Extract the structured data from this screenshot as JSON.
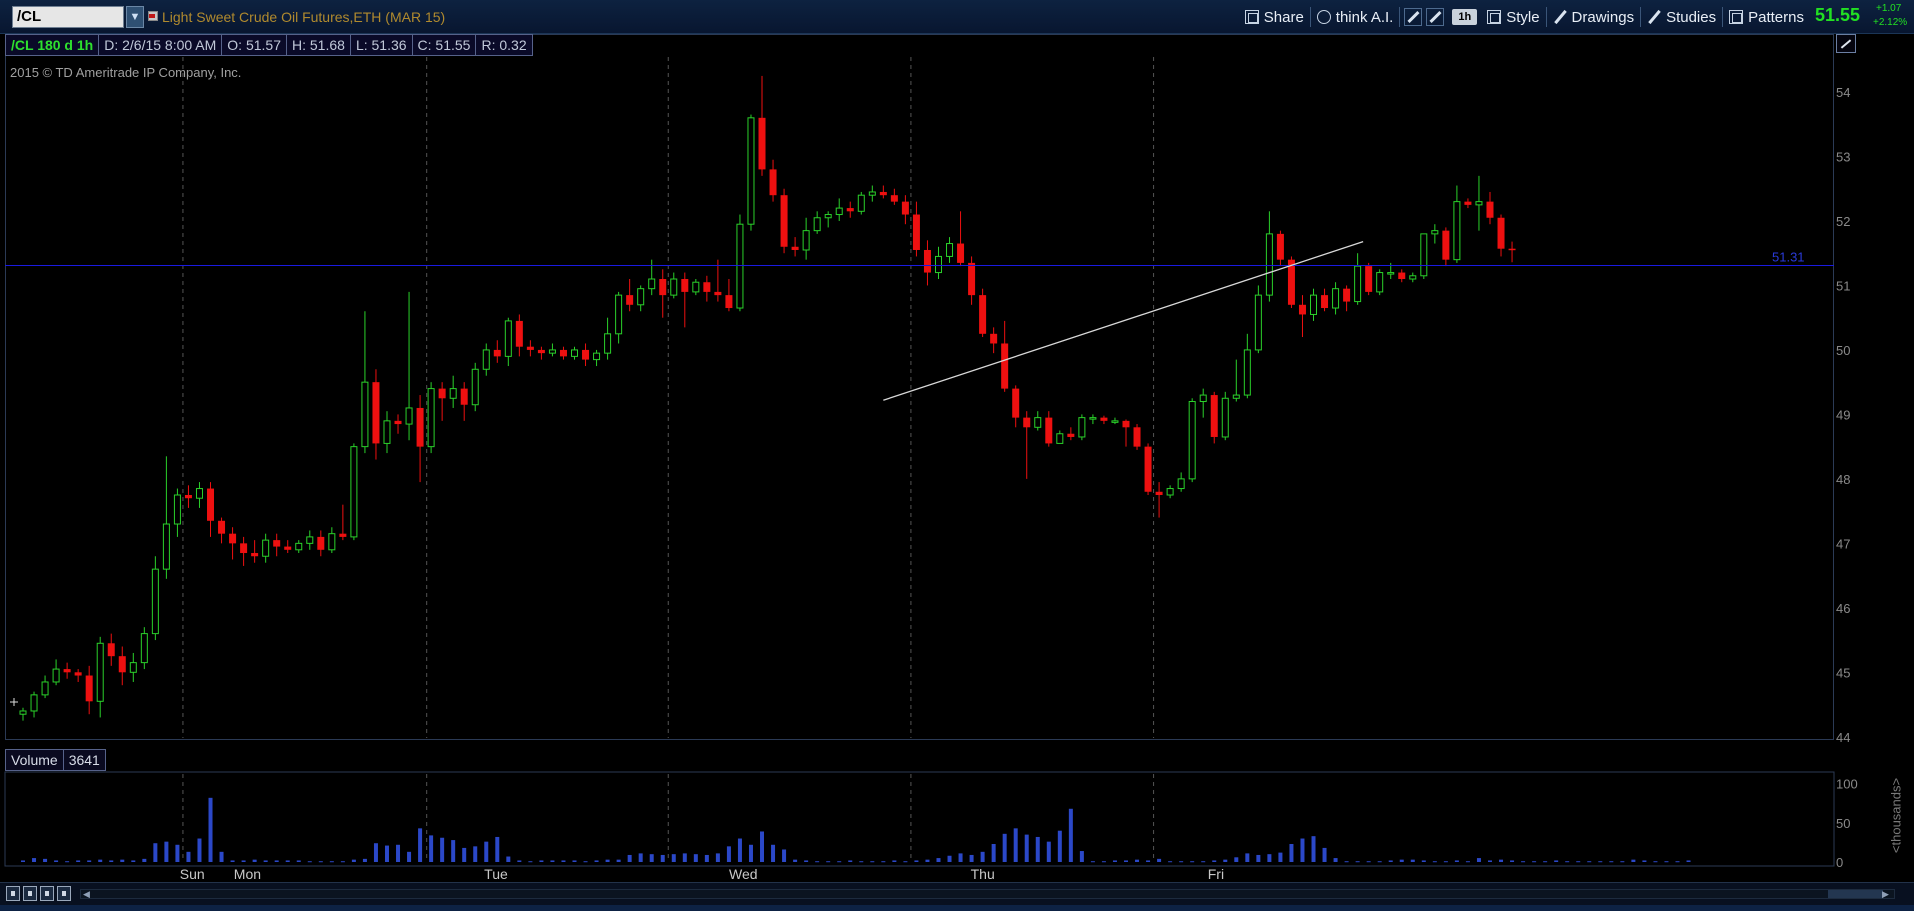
{
  "symbol": {
    "ticker": "/CL",
    "description": "Light Sweet Crude Oil Futures,ETH (MAR 15)",
    "dropdown_icon": "chevron-down-icon",
    "flag_icon": "flag-icon"
  },
  "toolbar": {
    "share_label": "Share",
    "think_label": "think A.I.",
    "aggregation_label": "1h",
    "style_label": "Style",
    "drawings_label": "Drawings",
    "studies_label": "Studies",
    "patterns_label": "Patterns"
  },
  "quote": {
    "last": "51.55",
    "change": "+1.07",
    "change_pct": "+2.12%",
    "up_color": "#22e022"
  },
  "infobar": {
    "symbol_period": "/CL 180 d 1h",
    "date": "D: 2/6/15 8:00 AM",
    "open": "O: 51.57",
    "high": "H: 51.68",
    "low": "L: 51.36",
    "close": "C: 51.55",
    "range": "R: 0.32"
  },
  "copyright": "2015 © TD Ameritrade IP Company, Inc.",
  "volume_bar": {
    "label": "Volume",
    "value": "3641",
    "unit_label": "<thousands>"
  },
  "colors": {
    "up": "#2ad12a",
    "down": "#ee1010",
    "volume": "#2b48c8",
    "price_line": "#1a1ae0",
    "trendline": "#d8d8d8",
    "grid": "#555555"
  },
  "chart_data": {
    "type": "candlestick",
    "price_axis_ticks": [
      44,
      45,
      46,
      47,
      48,
      49,
      50,
      51,
      52,
      53,
      54
    ],
    "price_range": [
      43.95,
      54.9
    ],
    "volume_axis_ticks": [
      {
        "value": 100,
        "label": "100"
      },
      {
        "value": 50,
        "label": "50"
      },
      {
        "value": 0,
        "label": "0"
      }
    ],
    "volume_range": [
      0,
      115
    ],
    "time_labels": [
      {
        "label": "Sun",
        "bar": 15.3
      },
      {
        "label": "Mon",
        "bar": 20.2
      },
      {
        "label": "Tue",
        "bar": 42.9
      },
      {
        "label": "Wed",
        "bar": 65.1
      },
      {
        "label": "Thu",
        "bar": 87.0
      },
      {
        "label": "Fri",
        "bar": 108.5
      }
    ],
    "session_separators": [
      14.5,
      36.6,
      58.5,
      80.5,
      102.5
    ],
    "price_line": {
      "value": "51.31",
      "label": "51.31"
    },
    "trendline": {
      "from": {
        "bar": 78,
        "price": 49.22
      },
      "to": {
        "bar": 121.5,
        "price": 51.68
      }
    },
    "candles": [
      [
        44.35,
        44.45,
        44.25,
        44.4
      ],
      [
        44.4,
        44.7,
        44.3,
        44.65
      ],
      [
        44.65,
        44.95,
        44.6,
        44.85
      ],
      [
        44.85,
        45.2,
        44.8,
        45.05
      ],
      [
        45.05,
        45.15,
        44.9,
        45.0
      ],
      [
        45.0,
        45.05,
        44.85,
        44.95
      ],
      [
        44.95,
        45.1,
        44.35,
        44.55
      ],
      [
        44.55,
        45.55,
        44.3,
        45.45
      ],
      [
        45.45,
        45.6,
        45.1,
        45.25
      ],
      [
        45.25,
        45.4,
        44.8,
        45.0
      ],
      [
        45.0,
        45.3,
        44.85,
        45.15
      ],
      [
        45.15,
        45.7,
        45.05,
        45.6
      ],
      [
        45.6,
        46.8,
        45.5,
        46.6
      ],
      [
        46.6,
        48.35,
        46.45,
        47.3
      ],
      [
        47.3,
        47.85,
        47.1,
        47.75
      ],
      [
        47.75,
        47.9,
        47.55,
        47.7
      ],
      [
        47.7,
        47.95,
        47.55,
        47.85
      ],
      [
        47.85,
        47.95,
        47.1,
        47.35
      ],
      [
        47.35,
        47.4,
        47.0,
        47.15
      ],
      [
        47.15,
        47.25,
        46.75,
        47.0
      ],
      [
        47.0,
        47.1,
        46.65,
        46.85
      ],
      [
        46.85,
        47.05,
        46.7,
        46.8
      ],
      [
        46.8,
        47.15,
        46.7,
        47.05
      ],
      [
        47.05,
        47.15,
        46.8,
        46.95
      ],
      [
        46.95,
        47.05,
        46.85,
        46.9
      ],
      [
        46.9,
        47.05,
        46.85,
        47.0
      ],
      [
        47.0,
        47.2,
        46.9,
        47.1
      ],
      [
        47.1,
        47.2,
        46.8,
        46.9
      ],
      [
        46.9,
        47.25,
        46.85,
        47.15
      ],
      [
        47.15,
        47.6,
        47.05,
        47.1
      ],
      [
        47.1,
        48.55,
        47.05,
        48.5
      ],
      [
        48.5,
        50.6,
        48.4,
        49.5
      ],
      [
        49.5,
        49.7,
        48.3,
        48.55
      ],
      [
        48.55,
        49.05,
        48.4,
        48.9
      ],
      [
        48.9,
        49.0,
        48.7,
        48.85
      ],
      [
        48.85,
        50.9,
        48.6,
        49.1
      ],
      [
        49.1,
        49.3,
        47.95,
        48.5
      ],
      [
        48.5,
        49.5,
        48.4,
        49.4
      ],
      [
        49.4,
        49.5,
        48.9,
        49.25
      ],
      [
        49.25,
        49.6,
        49.1,
        49.4
      ],
      [
        49.4,
        49.5,
        48.9,
        49.15
      ],
      [
        49.15,
        49.8,
        49.05,
        49.7
      ],
      [
        49.7,
        50.1,
        49.6,
        50.0
      ],
      [
        50.0,
        50.15,
        49.8,
        49.9
      ],
      [
        49.9,
        50.5,
        49.75,
        50.45
      ],
      [
        50.45,
        50.55,
        49.9,
        50.05
      ],
      [
        50.05,
        50.15,
        49.9,
        50.0
      ],
      [
        50.0,
        50.05,
        49.85,
        49.95
      ],
      [
        49.95,
        50.1,
        49.9,
        50.0
      ],
      [
        50.0,
        50.05,
        49.85,
        49.9
      ],
      [
        49.9,
        50.05,
        49.85,
        50.0
      ],
      [
        50.0,
        50.1,
        49.75,
        49.85
      ],
      [
        49.85,
        50.0,
        49.75,
        49.95
      ],
      [
        49.95,
        50.5,
        49.85,
        50.25
      ],
      [
        50.25,
        50.9,
        50.1,
        50.85
      ],
      [
        50.85,
        51.1,
        50.6,
        50.7
      ],
      [
        50.7,
        51.0,
        50.6,
        50.95
      ],
      [
        50.95,
        51.4,
        50.85,
        51.1
      ],
      [
        51.1,
        51.25,
        50.5,
        50.85
      ],
      [
        50.85,
        51.2,
        50.8,
        51.1
      ],
      [
        51.1,
        51.2,
        50.35,
        50.9
      ],
      [
        50.9,
        51.1,
        50.85,
        51.05
      ],
      [
        51.05,
        51.15,
        50.75,
        50.9
      ],
      [
        50.9,
        51.4,
        50.75,
        50.85
      ],
      [
        50.85,
        51.1,
        50.6,
        50.65
      ],
      [
        50.65,
        52.1,
        50.6,
        51.95
      ],
      [
        51.95,
        53.65,
        51.85,
        53.6
      ],
      [
        53.6,
        54.25,
        52.7,
        52.8
      ],
      [
        52.8,
        52.95,
        52.3,
        52.4
      ],
      [
        52.4,
        52.5,
        51.5,
        51.6
      ],
      [
        51.6,
        51.75,
        51.45,
        51.55
      ],
      [
        51.55,
        52.05,
        51.4,
        51.85
      ],
      [
        51.85,
        52.15,
        51.8,
        52.05
      ],
      [
        52.05,
        52.15,
        51.9,
        52.1
      ],
      [
        52.1,
        52.35,
        52.0,
        52.2
      ],
      [
        52.2,
        52.3,
        52.05,
        52.15
      ],
      [
        52.15,
        52.45,
        52.1,
        52.4
      ],
      [
        52.4,
        52.55,
        52.3,
        52.45
      ],
      [
        52.45,
        52.55,
        52.35,
        52.4
      ],
      [
        52.4,
        52.5,
        52.25,
        52.3
      ],
      [
        52.3,
        52.4,
        51.95,
        52.1
      ],
      [
        52.1,
        52.3,
        51.45,
        51.55
      ],
      [
        51.55,
        51.7,
        51.0,
        51.2
      ],
      [
        51.2,
        51.6,
        51.1,
        51.45
      ],
      [
        51.45,
        51.75,
        51.35,
        51.65
      ],
      [
        51.65,
        52.15,
        51.3,
        51.35
      ],
      [
        51.35,
        51.45,
        50.7,
        50.85
      ],
      [
        50.85,
        50.95,
        50.2,
        50.25
      ],
      [
        50.25,
        50.35,
        49.95,
        50.1
      ],
      [
        50.1,
        50.45,
        49.35,
        49.4
      ],
      [
        49.4,
        49.45,
        48.8,
        48.95
      ],
      [
        48.95,
        49.05,
        48.0,
        48.8
      ],
      [
        48.8,
        49.05,
        48.75,
        48.95
      ],
      [
        48.95,
        49.05,
        48.5,
        48.55
      ],
      [
        48.55,
        48.75,
        48.55,
        48.7
      ],
      [
        48.7,
        48.8,
        48.6,
        48.65
      ],
      [
        48.65,
        49.0,
        48.6,
        48.95
      ],
      [
        48.95,
        49.0,
        48.85,
        48.95
      ],
      [
        48.95,
        48.98,
        48.85,
        48.9
      ],
      [
        48.9,
        48.95,
        48.85,
        48.9
      ],
      [
        48.9,
        48.92,
        48.5,
        48.8
      ],
      [
        48.8,
        48.85,
        48.45,
        48.5
      ],
      [
        48.5,
        48.55,
        47.75,
        47.8
      ],
      [
        47.8,
        47.95,
        47.4,
        47.75
      ],
      [
        47.75,
        47.9,
        47.7,
        47.85
      ],
      [
        47.85,
        48.1,
        47.8,
        48.0
      ],
      [
        48.0,
        49.25,
        47.95,
        49.2
      ],
      [
        49.2,
        49.4,
        48.95,
        49.3
      ],
      [
        49.3,
        49.35,
        48.55,
        48.65
      ],
      [
        48.65,
        49.35,
        48.6,
        49.25
      ],
      [
        49.25,
        49.85,
        49.2,
        49.3
      ],
      [
        49.3,
        50.25,
        49.25,
        50.0
      ],
      [
        50.0,
        51.0,
        49.95,
        50.85
      ],
      [
        50.85,
        52.15,
        50.75,
        51.8
      ],
      [
        51.8,
        51.85,
        51.3,
        51.4
      ],
      [
        51.4,
        51.45,
        50.65,
        50.7
      ],
      [
        50.7,
        50.85,
        50.2,
        50.55
      ],
      [
        50.55,
        50.95,
        50.45,
        50.85
      ],
      [
        50.85,
        50.95,
        50.6,
        50.65
      ],
      [
        50.65,
        51.05,
        50.55,
        50.95
      ],
      [
        50.95,
        51.0,
        50.6,
        50.75
      ],
      [
        50.75,
        51.5,
        50.7,
        51.3
      ],
      [
        51.3,
        51.35,
        50.85,
        50.9
      ],
      [
        50.9,
        51.25,
        50.85,
        51.2
      ],
      [
        51.2,
        51.35,
        51.1,
        51.2
      ],
      [
        51.2,
        51.25,
        51.05,
        51.1
      ],
      [
        51.1,
        51.2,
        51.05,
        51.15
      ],
      [
        51.15,
        51.8,
        51.1,
        51.8
      ],
      [
        51.8,
        51.95,
        51.65,
        51.85
      ],
      [
        51.85,
        51.9,
        51.3,
        51.4
      ],
      [
        51.4,
        52.55,
        51.35,
        52.3
      ],
      [
        52.3,
        52.35,
        52.2,
        52.25
      ],
      [
        52.25,
        52.7,
        51.85,
        52.3
      ],
      [
        52.3,
        52.45,
        51.95,
        52.05
      ],
      [
        52.05,
        52.1,
        51.45,
        51.57
      ],
      [
        51.57,
        51.68,
        51.36,
        51.55
      ]
    ],
    "volumes": [
      2,
      5,
      4,
      2,
      1,
      2,
      2,
      3,
      2,
      3,
      2,
      4,
      24,
      26,
      22,
      13,
      30,
      82,
      13,
      2,
      2,
      3,
      2,
      2,
      2,
      2,
      1,
      1,
      1,
      1,
      3,
      4,
      24,
      21,
      22,
      13,
      43,
      34,
      31,
      28,
      18,
      20,
      26,
      32,
      7,
      2,
      1,
      2,
      2,
      2,
      2,
      1,
      2,
      3,
      3,
      9,
      11,
      10,
      9,
      10,
      11,
      10,
      9,
      11,
      20,
      30,
      22,
      39,
      22,
      16,
      3,
      2,
      1,
      1,
      1,
      2,
      1,
      1,
      1,
      2,
      1,
      2,
      3,
      5,
      8,
      11,
      9,
      13,
      23,
      36,
      43,
      35,
      32,
      26,
      40,
      68,
      14,
      1,
      1,
      2,
      2,
      3,
      2,
      4,
      1,
      1,
      1,
      1,
      2,
      3,
      6,
      11,
      9,
      10,
      12,
      23,
      30,
      33,
      18,
      5,
      1,
      1,
      1,
      1,
      2,
      3,
      3,
      2,
      1,
      1,
      2,
      1,
      5,
      2,
      3,
      2,
      1,
      1,
      1,
      2,
      1,
      1,
      1,
      1,
      1,
      1,
      3,
      2,
      1,
      1,
      1,
      2
    ]
  }
}
